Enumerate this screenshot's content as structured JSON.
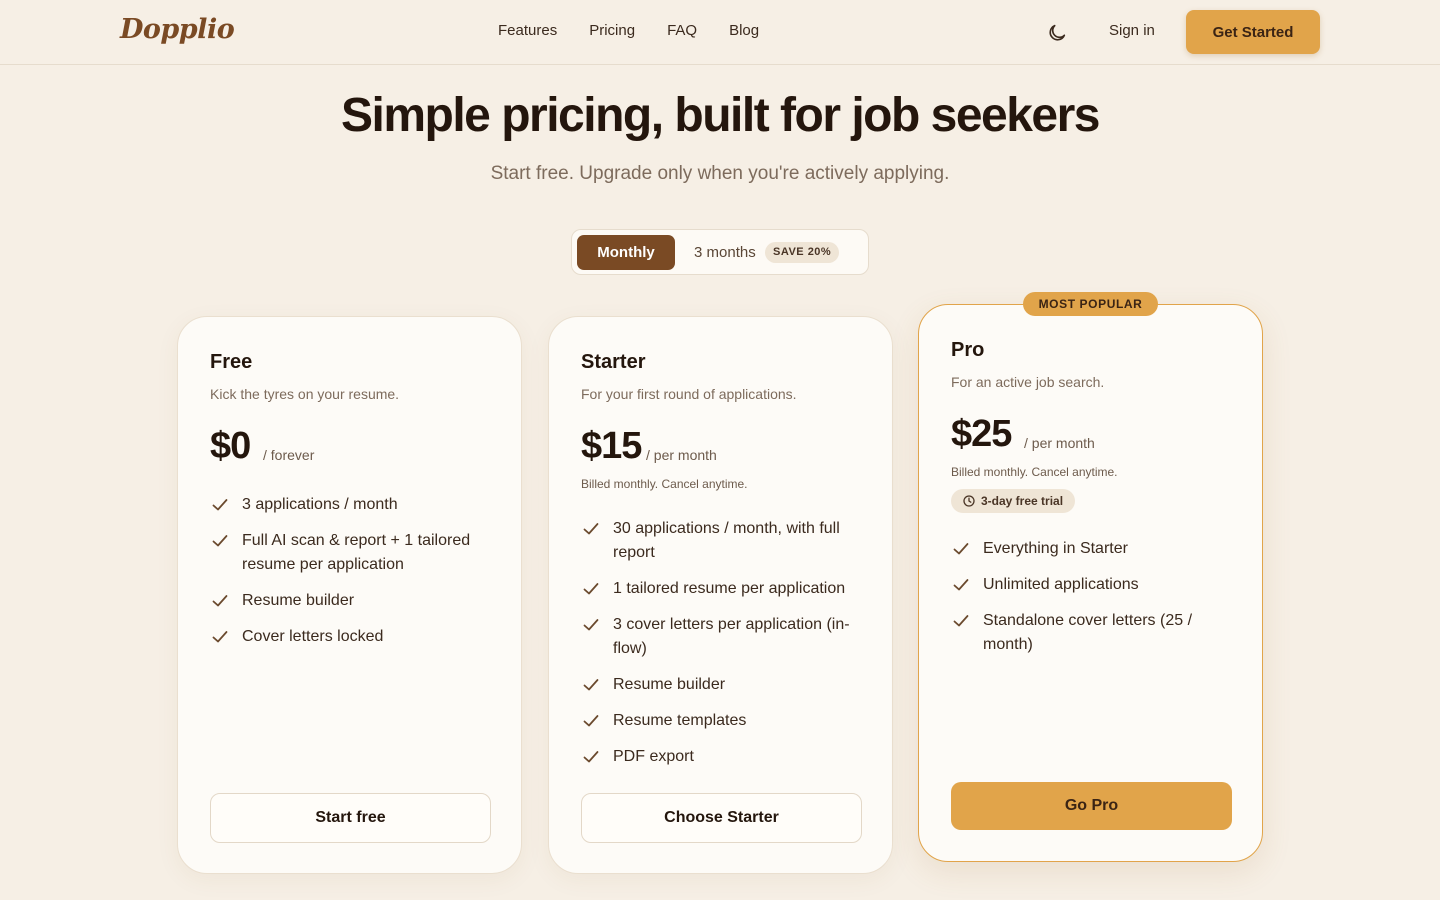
{
  "brand": {
    "name": "Dopplio"
  },
  "nav": {
    "links": [
      "Features",
      "Pricing",
      "FAQ",
      "Blog"
    ],
    "signin": "Sign in",
    "cta": "Get Started"
  },
  "hero": {
    "title": "Simple pricing, built for job seekers",
    "subtitle": "Start free. Upgrade only when you're actively applying."
  },
  "billing_toggle": {
    "monthly": "Monthly",
    "three_months": "3 months",
    "save_badge": "SAVE 20%",
    "selected": "Monthly"
  },
  "plans": [
    {
      "name": "Free",
      "description": "Kick the tyres on your resume.",
      "price": "$0",
      "period": "/ forever",
      "features": [
        "3 applications / month",
        "Full AI scan & report + 1 tailored resume per application",
        "Resume builder",
        "Cover letters locked"
      ],
      "cta": "Start free"
    },
    {
      "name": "Starter",
      "description": "For your first round of applications.",
      "price": "$15",
      "period": "/ per month",
      "billed": "Billed monthly. Cancel anytime.",
      "features": [
        "30 applications / month, with full report",
        "1 tailored resume per application",
        "3 cover letters per application (in-flow)",
        "Resume builder",
        "Resume templates",
        "PDF export"
      ],
      "cta": "Choose Starter"
    },
    {
      "name": "Pro",
      "badge": "MOST POPULAR",
      "description": "For an active job search.",
      "price": "$25",
      "period": "/ per month",
      "billed": "Billed monthly. Cancel anytime.",
      "trial": "3-day free trial",
      "features": [
        "Everything in Starter",
        "Unlimited applications",
        "Standalone cover letters (25 / month)"
      ],
      "cta": "Go Pro"
    }
  ],
  "colors": {
    "background": "#f6efe5",
    "accent": "#e1a44a",
    "brand_brown": "#7a4a24",
    "text_dark": "#24160d"
  },
  "icons": {
    "theme_toggle": "moon-icon",
    "feature_check": "check-icon",
    "trial": "clock-icon"
  }
}
